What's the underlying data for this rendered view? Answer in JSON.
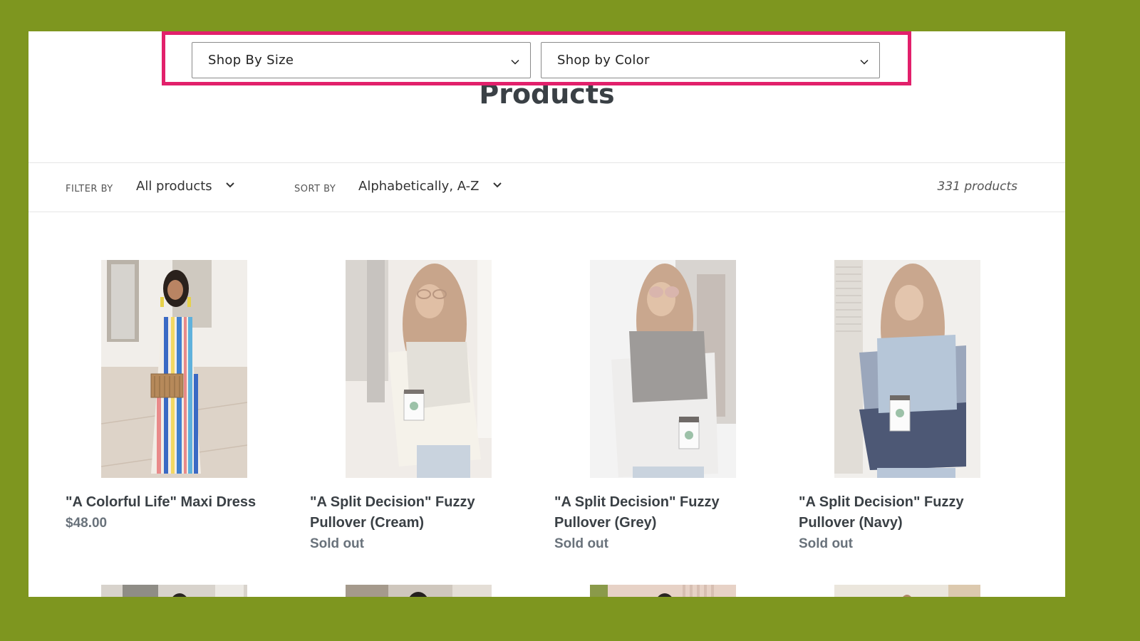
{
  "colors": {
    "frame_background": "#7e961f",
    "highlight_border": "#e2206b",
    "title_text": "#3a4045",
    "status_text": "#69727b"
  },
  "shop_filters": {
    "size": {
      "label": "Shop By Size",
      "icon": "chevron-down-icon"
    },
    "color": {
      "label": "Shop by Color",
      "icon": "chevron-down-icon"
    }
  },
  "page": {
    "title": "Products"
  },
  "filter_bar": {
    "filter_label": "FILTER BY",
    "filter_value": "All products",
    "sort_label": "SORT BY",
    "sort_value": "Alphabetically, A-Z",
    "product_count": "331 products"
  },
  "products": [
    {
      "title": "\"A Colorful Life\" Maxi Dress",
      "status": "$48.00",
      "image": "woman in striped maxi dress holding bamboo bag"
    },
    {
      "title": "\"A Split Decision\" Fuzzy Pullover (Cream)",
      "status": "Sold out",
      "image": "woman in cream fuzzy pullover holding coffee cup"
    },
    {
      "title": "\"A Split Decision\" Fuzzy Pullover (Grey)",
      "status": "Sold out",
      "image": "woman in grey fuzzy pullover holding coffee cup"
    },
    {
      "title": "\"A Split Decision\" Fuzzy Pullover (Navy)",
      "status": "Sold out",
      "image": "woman in navy fuzzy pullover holding coffee cup"
    }
  ]
}
